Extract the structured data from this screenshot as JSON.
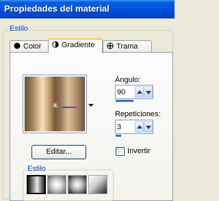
{
  "window": {
    "title": "Propiedades del material"
  },
  "group": {
    "label": "Estilo"
  },
  "tabs": [
    {
      "label": "Color",
      "icon": "filled-circle-icon",
      "active": false
    },
    {
      "label": "Gradiente",
      "icon": "half-circle-icon",
      "active": true
    },
    {
      "label": "Trama",
      "icon": "pattern-icon",
      "active": false
    }
  ],
  "angle": {
    "label": "Ángulo:",
    "value": "90"
  },
  "repeats": {
    "label": "Repeticiones:",
    "value": "3"
  },
  "edit_button": {
    "label": "Editar..."
  },
  "invert": {
    "label": "Invertir",
    "checked": false
  },
  "style_group": {
    "label": "Estilo"
  },
  "colors": {
    "title_bar": "#0054e3",
    "accent_blue": "#0046d5",
    "tab_highlight": "#ffc83c"
  }
}
